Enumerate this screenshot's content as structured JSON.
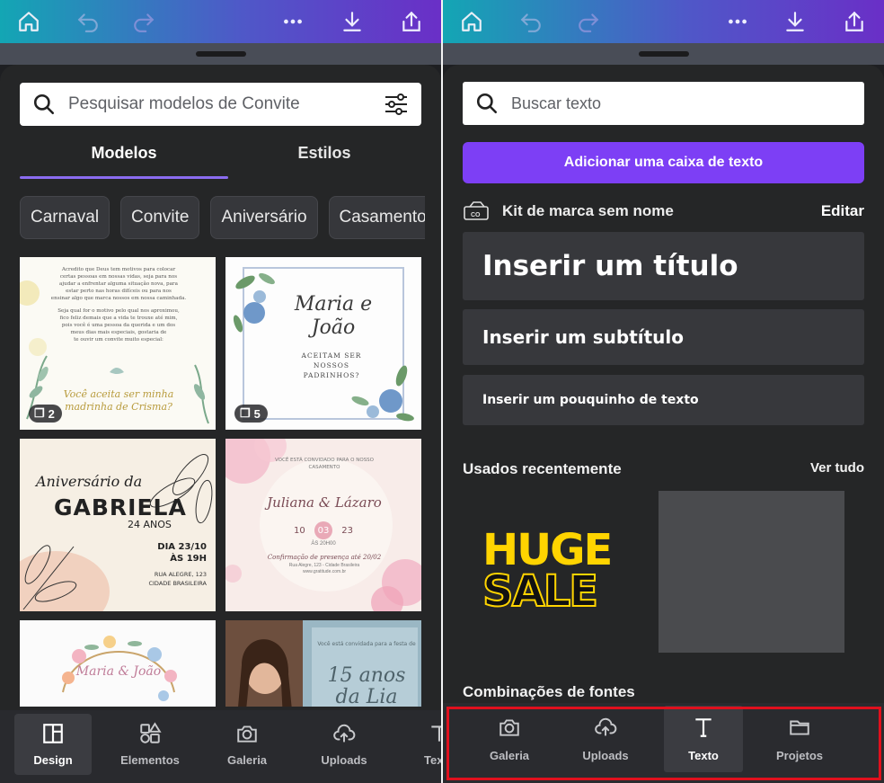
{
  "left": {
    "toolbar": {
      "icons": [
        "home-icon",
        "undo-icon",
        "redo-icon",
        "more-icon",
        "download-icon",
        "share-icon"
      ]
    },
    "search": {
      "placeholder": "Pesquisar modelos de Convite"
    },
    "tabs": [
      {
        "label": "Modelos",
        "active": true
      },
      {
        "label": "Estilos",
        "active": false
      }
    ],
    "chips": [
      "Carnaval",
      "Convite",
      "Aniversário",
      "Casamento"
    ],
    "templates": [
      {
        "lines": [
          "Acredito que Deus tem motivos para colocar",
          "certas pessoas em nossas vidas, seja para nos",
          "ajudar a enfrentar alguma situação nova, para",
          "estar perto nas horas difíceis ou para nos",
          "ensinar algo que marca nossos em nossa caminhada.",
          "Seja qual for o motivo pelo qual nos aproximou,",
          "fico feliz demais que a vida te trouxe até mim,",
          "pois você é uma pessoa da querida e um dos",
          "meus dias mais especiais, gostaria de",
          "te ouvir um convite muito especial:"
        ],
        "script": "Você aceita ser minha madrinha de Crisma?",
        "count": "2"
      },
      {
        "title": "Maria e João",
        "subtitle": "ACEITAM SER NOSSOS PADRINHOS?",
        "count": "5"
      },
      {
        "script": "Aniversário da",
        "name": "GABRIELA",
        "age": "24 ANOS",
        "date": "DIA 23/10",
        "time": "ÀS 19H",
        "address": "RUA ALEGRE, 123",
        "city": "CIDADE BRASILEIRA"
      },
      {
        "top": "VOCÊ ESTÁ CONVIDADO PARA O NOSSO CASAMENTO",
        "names": "Juliana & Lázaro",
        "day_left": "10",
        "day": "03",
        "day_right": "23",
        "time": "ÀS 20H00",
        "rsvp": "Confirmação de presença até 20/02",
        "address": "Rua Alegre, 123 - Cidade Brasileira",
        "site": "www.gratitude.com.br"
      },
      {
        "script": "Maria & João"
      },
      {
        "top": "Você está convidada para a festa de",
        "script": "15 anos da Lia"
      }
    ],
    "nav": [
      {
        "label": "Design",
        "icon": "design-icon",
        "active": true
      },
      {
        "label": "Elementos",
        "icon": "elements-icon",
        "active": false
      },
      {
        "label": "Galeria",
        "icon": "camera-icon",
        "active": false
      },
      {
        "label": "Uploads",
        "icon": "cloud-upload-icon",
        "active": false
      },
      {
        "label": "Texto",
        "icon": "text-icon",
        "active": false
      }
    ]
  },
  "right": {
    "toolbar": {
      "icons": [
        "home-icon",
        "undo-icon",
        "redo-icon",
        "more-icon",
        "download-icon",
        "share-icon"
      ]
    },
    "search": {
      "placeholder": "Buscar texto"
    },
    "add_button": "Adicionar uma caixa de texto",
    "brand_kit": {
      "label": "Kit de marca sem nome",
      "edit": "Editar"
    },
    "text_options": {
      "title": "Inserir um título",
      "subtitle": "Inserir um subtítulo",
      "body": "Inserir um pouquinho de texto"
    },
    "recent": {
      "title": "Usados recentemente",
      "see_all": "Ver tudo",
      "huge": "HUGE",
      "sale": "SALE"
    },
    "font_combos": "Combinações de fontes",
    "nav": [
      {
        "label": "Galeria",
        "icon": "camera-icon",
        "active": false
      },
      {
        "label": "Uploads",
        "icon": "cloud-upload-icon",
        "active": false
      },
      {
        "label": "Texto",
        "icon": "text-icon",
        "active": true
      },
      {
        "label": "Projetos",
        "icon": "folder-icon",
        "active": false
      }
    ]
  },
  "colors": {
    "accent": "#7d3ff5",
    "panel": "#252627",
    "highlight_box": "#e0101d"
  }
}
